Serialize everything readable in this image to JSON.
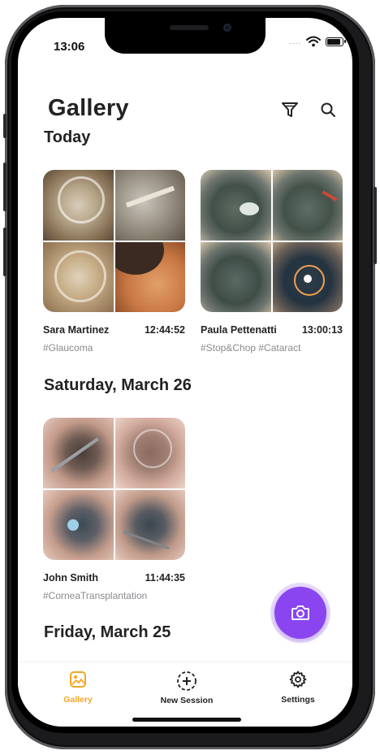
{
  "status_bar": {
    "time": "13:06",
    "signal_dots": "...."
  },
  "header": {
    "title": "Gallery",
    "filter_icon": "filter-icon",
    "search_icon": "search-icon"
  },
  "sections": [
    {
      "title": "Today",
      "items": [
        {
          "name": "Sara Martinez",
          "time": "12:44:52",
          "tags": "#Glaucoma"
        },
        {
          "name": "Paula Pettenatti",
          "time": "13:00:13",
          "tags": "#Stop&Chop #Cataract"
        }
      ]
    },
    {
      "title": "Saturday, March 26",
      "items": [
        {
          "name": "John Smith",
          "time": "11:44:35",
          "tags": "#CorneaTransplantation"
        }
      ]
    },
    {
      "title": "Friday, March 25",
      "items": []
    }
  ],
  "fab": {
    "icon": "camera-icon"
  },
  "tab_bar": {
    "items": [
      {
        "label": "Gallery",
        "icon": "gallery-icon",
        "active": true
      },
      {
        "label": "New Session",
        "icon": "new-session-icon",
        "active": false
      },
      {
        "label": "Settings",
        "icon": "settings-icon",
        "active": false
      }
    ]
  },
  "colors": {
    "accent": "#8A45F0",
    "active_tab": "#F5A623"
  }
}
